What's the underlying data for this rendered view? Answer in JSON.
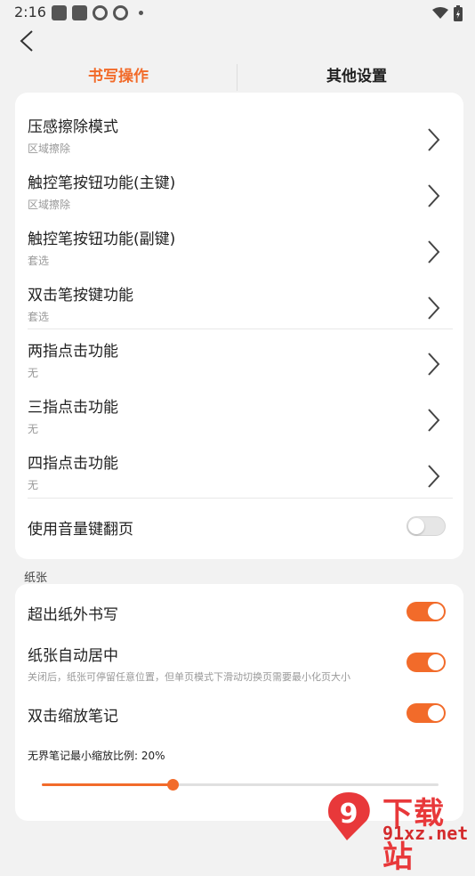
{
  "status_bar": {
    "time": "2:16"
  },
  "tabs": [
    {
      "label": "书写操作",
      "active": true
    },
    {
      "label": "其他设置",
      "active": false
    }
  ],
  "colors": {
    "accent": "#f26b2a",
    "background": "#f2f2f2"
  },
  "writing_ops": {
    "items": [
      {
        "title": "压感擦除模式",
        "subtitle": "区域擦除"
      },
      {
        "title": "触控笔按钮功能(主键)",
        "subtitle": "区域擦除"
      },
      {
        "title": "触控笔按钮功能(副键)",
        "subtitle": "套选"
      },
      {
        "title": "双击笔按键功能",
        "subtitle": "套选"
      },
      {
        "title": "两指点击功能",
        "subtitle": "无"
      },
      {
        "title": "三指点击功能",
        "subtitle": "无"
      },
      {
        "title": "四指点击功能",
        "subtitle": "无"
      }
    ],
    "volume_page_turn": {
      "label": "使用音量键翻页",
      "enabled": false
    }
  },
  "paper": {
    "section_label": "纸张",
    "out_of_paper": {
      "label": "超出纸外书写",
      "enabled": true
    },
    "auto_center": {
      "label": "纸张自动居中",
      "desc": "关闭后，纸张可停留任意位置，但单页模式下滑动切换页需要最小化页大小",
      "enabled": true
    },
    "double_tap_zoom": {
      "label": "双击缩放笔记",
      "enabled": true
    },
    "min_zoom": {
      "label": "无界笔记最小缩放比例: 20%",
      "value_fraction": 0.33
    }
  },
  "watermark": {
    "text1": "下载站",
    "text2": "91xz.net",
    "logo_text": "9"
  }
}
